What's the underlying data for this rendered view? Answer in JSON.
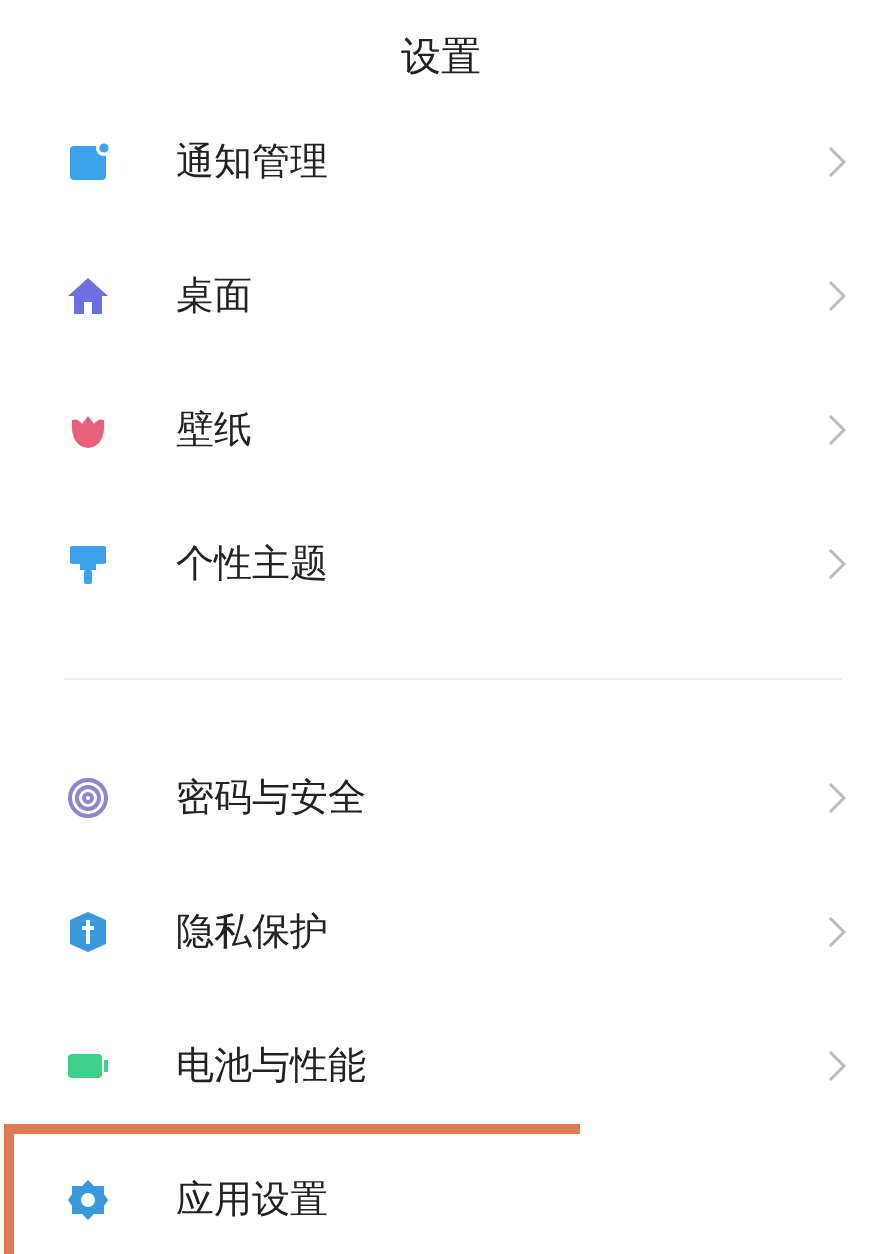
{
  "title": "设置",
  "sections": [
    {
      "items": [
        {
          "label": "通知管理",
          "chevron": true,
          "highlighted": false
        },
        {
          "label": "桌面",
          "chevron": true,
          "highlighted": false
        },
        {
          "label": "壁纸",
          "chevron": true,
          "highlighted": false
        },
        {
          "label": "个性主题",
          "chevron": true,
          "highlighted": false
        }
      ]
    },
    {
      "items": [
        {
          "label": "密码与安全",
          "chevron": true,
          "highlighted": false
        },
        {
          "label": "隐私保护",
          "chevron": true,
          "highlighted": false
        },
        {
          "label": "电池与性能",
          "chevron": true,
          "highlighted": false
        },
        {
          "label": "应用设置",
          "chevron": false,
          "highlighted": true
        }
      ]
    }
  ]
}
